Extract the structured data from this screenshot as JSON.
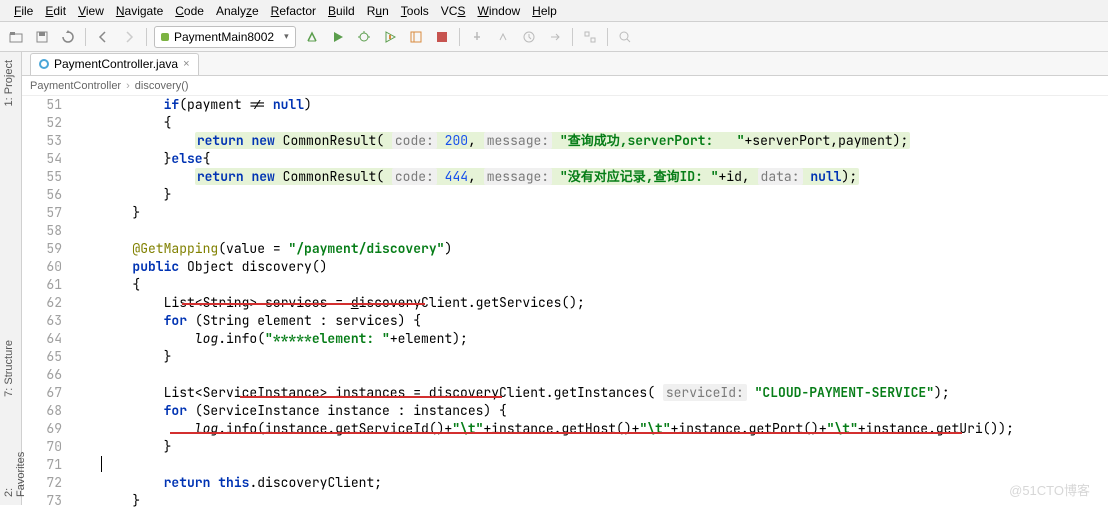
{
  "menu": [
    "File",
    "Edit",
    "View",
    "Navigate",
    "Code",
    "Analyze",
    "Refactor",
    "Build",
    "Run",
    "Tools",
    "VCS",
    "Window",
    "Help"
  ],
  "run_config": "PaymentMain8002",
  "tab": {
    "file": "PaymentController.java"
  },
  "breadcrumb": {
    "a": "PaymentController",
    "b": "discovery()"
  },
  "lines": {
    "start": 51,
    "end": 73
  },
  "code": {
    "l51": "if(payment != null)",
    "l52": "{",
    "l53_pre": "    ",
    "l53_ret": "return",
    "l53_new": " new ",
    "l53_cls": "CommonResult( ",
    "l53_p1": "code:",
    "l53_c1": " 200",
    "l53_c1b": ", ",
    "l53_p2": "message:",
    "l53_s1": " \"查询成功,serverPort:   \"",
    "l53_tail": "+serverPort,payment);",
    "l54": "}else{",
    "l55_pre": "    ",
    "l55_ret": "return",
    "l55_new": " new ",
    "l55_cls": "CommonResult( ",
    "l55_p1": "code:",
    "l55_c1": " 444",
    "l55_c1b": ", ",
    "l55_p2": "message:",
    "l55_s1": " \"没有对应记录,查询ID: \"",
    "l55_mid": "+id, ",
    "l55_p3": "data:",
    "l55_tail": " null);",
    "l56": "}",
    "l57": "}",
    "l59_ann": "@GetMapping",
    "l59_mid": "(value = ",
    "l59_str": "\"/payment/discovery\"",
    "l59_end": ")",
    "l60_pub": "public",
    "l60_rest": " Object discovery()",
    "l61": "{",
    "l62_a": "List<String> services = ",
    "l62_b": "discoveryClient",
    "l62_c": ".",
    "l62_d": "getServices",
    "l62_e": "();",
    "l63_for": "for",
    "l63_rest": " (String element : services) {",
    "l64_log": "log",
    "l64_mid": ".info(",
    "l64_str": "\"*****element: \"",
    "l64_end": "+element);",
    "l65": "}",
    "l67_a": "List<ServiceInstance> instances = ",
    "l67_b": "discoveryClient",
    "l67_c": ".",
    "l67_d": "getInstances",
    "l67_e": "( ",
    "l67_p": "serviceId:",
    "l67_s": " \"CLOUD-PAYMENT-SERVICE\"",
    "l67_end": ");",
    "l68_for": "for",
    "l68_rest": " (ServiceInstance instance : instances) {",
    "l69_log": "log",
    "l69_mid": ".info(instance.getServiceId()+",
    "l69_t1": "\"\\t\"",
    "l69_m2": "+instance.getHost()+",
    "l69_t2": "\"\\t\"",
    "l69_m3": "+instance.getPort()+",
    "l69_t3": "\"\\t\"",
    "l69_m4": "+instance.getUri());",
    "l70": "}",
    "l72_ret": "return",
    "l72_this": " this",
    "l72_rest": ".discoveryClient;",
    "l73": "}"
  },
  "sidebar": {
    "project": "1: Project",
    "structure": "7: Structure",
    "favorites": "2: Favorites"
  },
  "watermark": "@51CTO博客"
}
